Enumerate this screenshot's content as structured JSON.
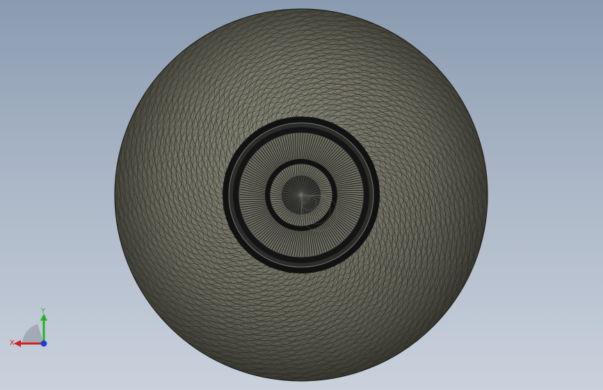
{
  "viewport": {
    "background_top": "#8a9bb1",
    "background_bottom": "#c9d1dc",
    "model": {
      "shape": "torus-wheel-mesh",
      "surface_color": "#6f6e60",
      "mesh_line_color": "#111111",
      "hub_color": "#1a1a1a"
    }
  },
  "triad": {
    "x_label": "X",
    "y_label": "Y",
    "x_color": "#d21f1f",
    "y_color": "#1fb41f",
    "z_color": "#1f3fd2"
  }
}
